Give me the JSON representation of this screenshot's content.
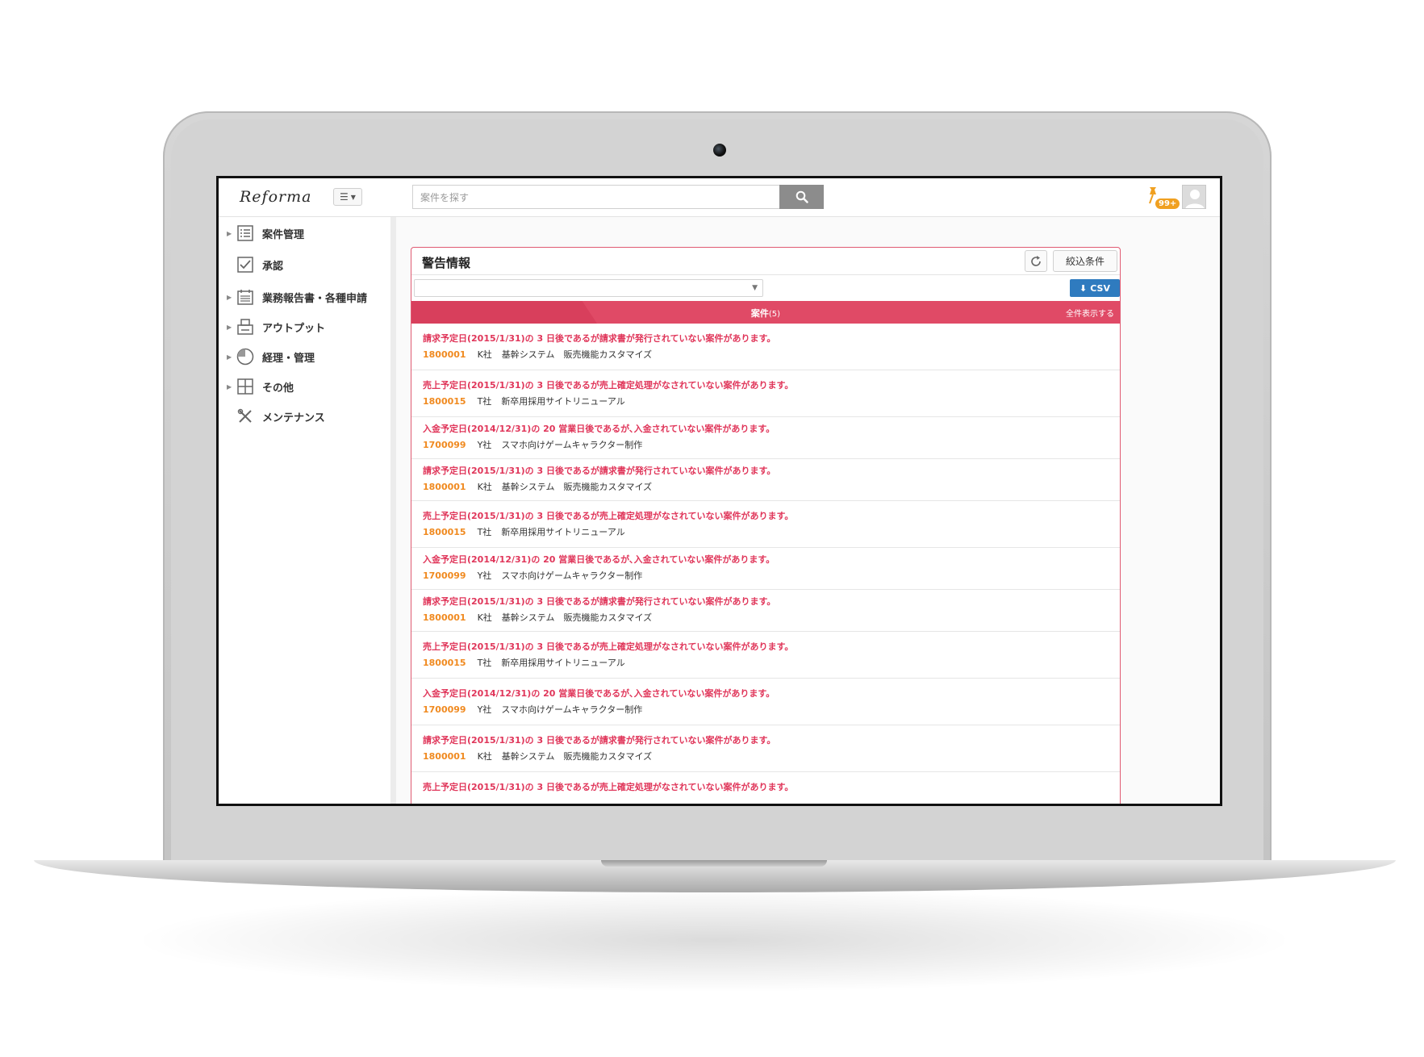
{
  "app": {
    "logo": "Reforma"
  },
  "search": {
    "placeholder": "案件を探す"
  },
  "notifications": {
    "badge": "99+"
  },
  "sidebar": {
    "items": [
      {
        "label": "案件管理",
        "icon": "list-icon",
        "has_children": true
      },
      {
        "label": "承認",
        "icon": "checkbox-icon",
        "has_children": false
      },
      {
        "label": "業務報告書・各種申請",
        "icon": "calendar-icon",
        "has_children": true
      },
      {
        "label": "アウトプット",
        "icon": "printer-icon",
        "has_children": true
      },
      {
        "label": "経理・管理",
        "icon": "pie-chart-icon",
        "has_children": true
      },
      {
        "label": "その他",
        "icon": "plus-box-icon",
        "has_children": true
      },
      {
        "label": "メンテナンス",
        "icon": "tools-icon",
        "has_children": false
      }
    ]
  },
  "panel": {
    "title": "警告情報",
    "filter_label": "絞込条件",
    "csv_label": "CSV",
    "select_value": "",
    "tab": {
      "label": "案件",
      "count": "(5)",
      "show_all": "全件表示する"
    }
  },
  "alerts": [
    {
      "message": "請求予定日(2015/1/31)の 3 日後であるが請求書が発行されていない案件があります。",
      "id": "1800001",
      "company": "K社",
      "project": "基幹システム　販売機能カスタマイズ"
    },
    {
      "message": "売上予定日(2015/1/31)の 3 日後であるが売上確定処理がなされていない案件があります。",
      "id": "1800015",
      "company": "T社",
      "project": "新卒用採用サイトリニューアル"
    },
    {
      "message": "入金予定日(2014/12/31)の 20 営業日後であるが､入金されていない案件があります。",
      "id": "1700099",
      "company": "Y社",
      "project": "スマホ向けゲームキャラクター制作"
    },
    {
      "message": "請求予定日(2015/1/31)の 3 日後であるが請求書が発行されていない案件があります。",
      "id": "1800001",
      "company": "K社",
      "project": "基幹システム　販売機能カスタマイズ"
    },
    {
      "message": "売上予定日(2015/1/31)の 3 日後であるが売上確定処理がなされていない案件があります。",
      "id": "1800015",
      "company": "T社",
      "project": "新卒用採用サイトリニューアル"
    },
    {
      "message": "入金予定日(2014/12/31)の 20 営業日後であるが､入金されていない案件があります。",
      "id": "1700099",
      "company": "Y社",
      "project": "スマホ向けゲームキャラクター制作"
    },
    {
      "message": "請求予定日(2015/1/31)の 3 日後であるが請求書が発行されていない案件があります。",
      "id": "1800001",
      "company": "K社",
      "project": "基幹システム　販売機能カスタマイズ"
    },
    {
      "message": "売上予定日(2015/1/31)の 3 日後であるが売上確定処理がなされていない案件があります。",
      "id": "1800015",
      "company": "T社",
      "project": "新卒用採用サイトリニューアル"
    },
    {
      "message": "入金予定日(2014/12/31)の 20 営業日後であるが､入金されていない案件があります。",
      "id": "1700099",
      "company": "Y社",
      "project": "スマホ向けゲームキャラクター制作"
    },
    {
      "message": "請求予定日(2015/1/31)の 3 日後であるが請求書が発行されていない案件があります。",
      "id": "1800001",
      "company": "K社",
      "project": "基幹システム　販売機能カスタマイズ"
    },
    {
      "message": "売上予定日(2015/1/31)の 3 日後であるが売上確定処理がなされていない案件があります。",
      "id": "",
      "company": "",
      "project": ""
    }
  ],
  "colors": {
    "accent": "#e04a66",
    "alert_text": "#e0365a",
    "id_text": "#f08a20",
    "csv_button": "#2f7bbf"
  }
}
